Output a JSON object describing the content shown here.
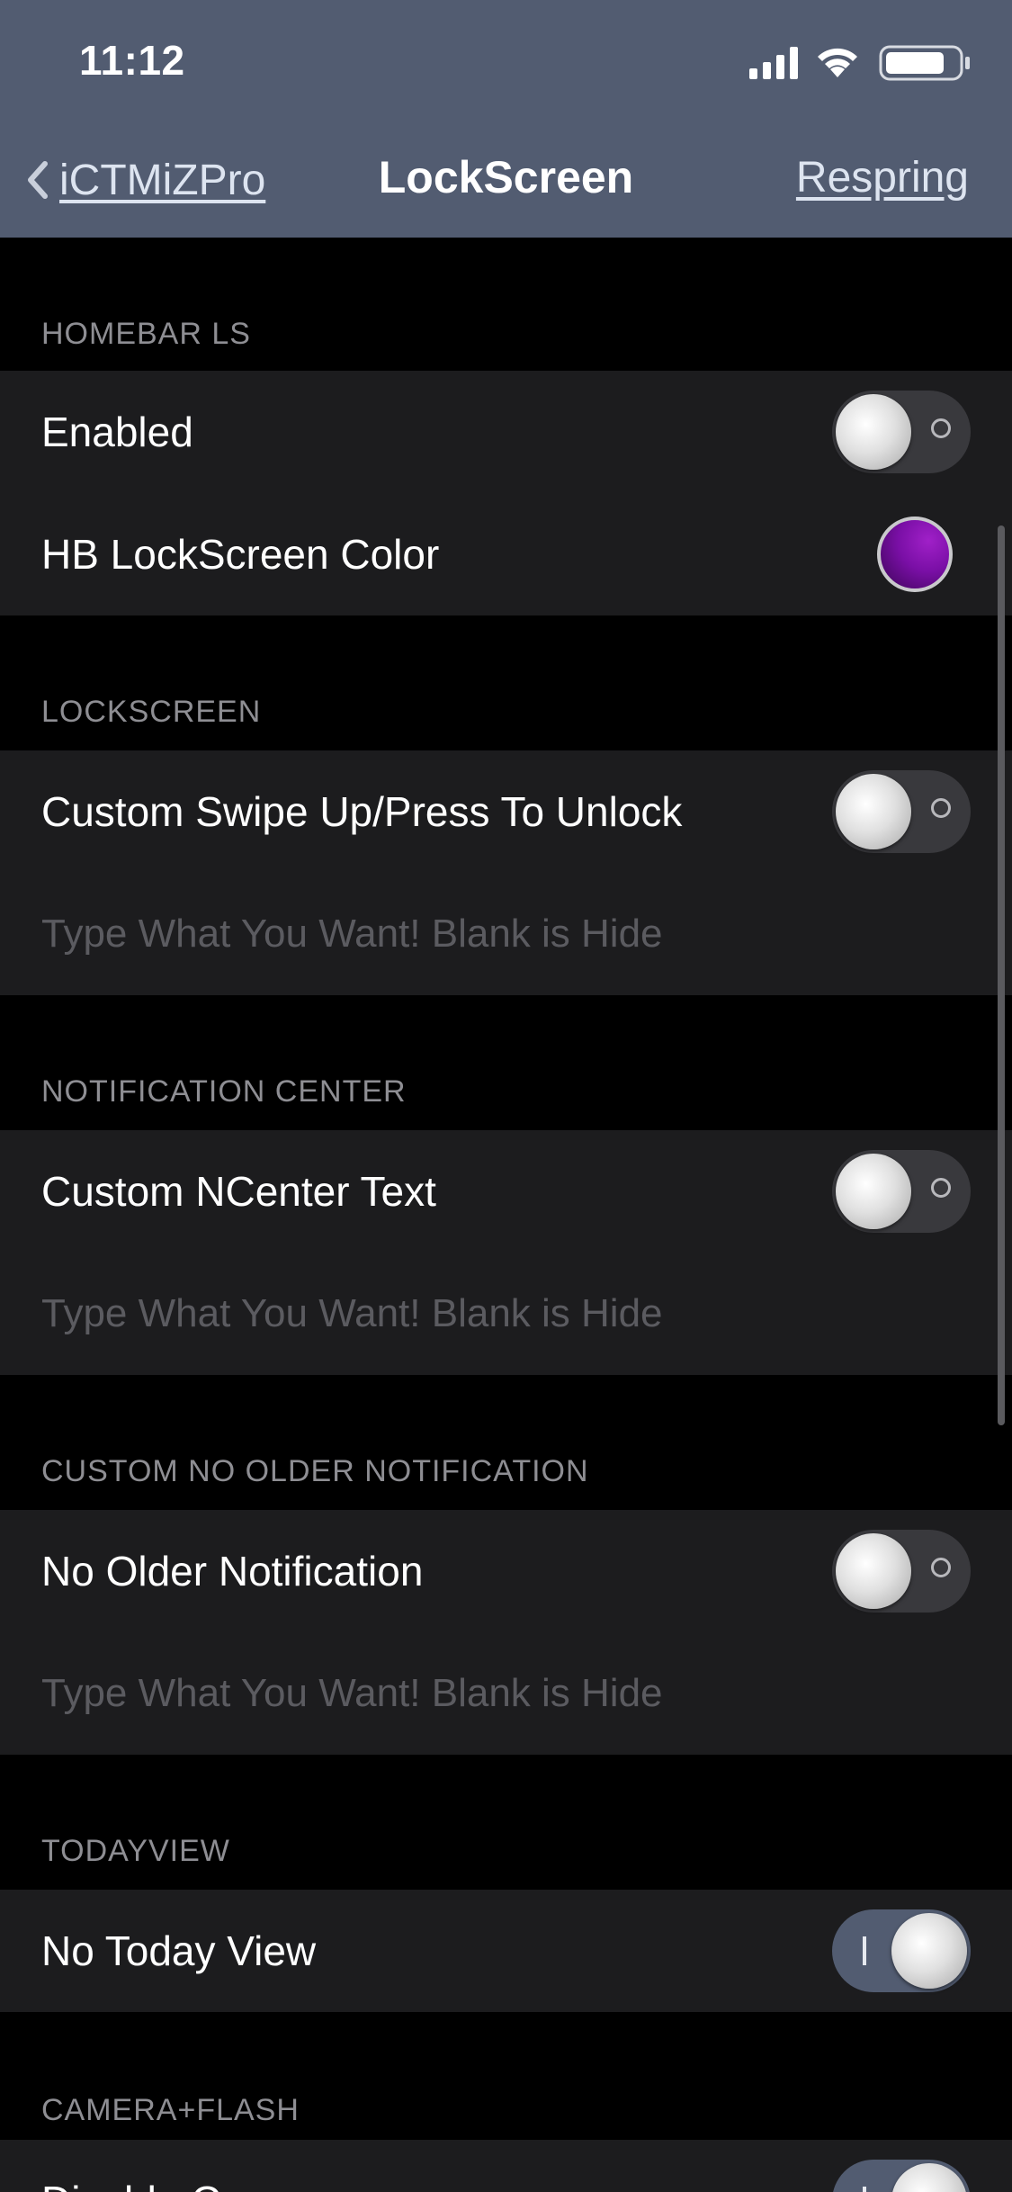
{
  "status_bar": {
    "time": "11:12"
  },
  "nav": {
    "back_label": "iCTMiZPro",
    "title": "LockScreen",
    "action_label": "Respring"
  },
  "sections": [
    {
      "header": "HOMEBAR LS",
      "rows": [
        {
          "label": "Enabled",
          "toggle": "off"
        },
        {
          "label": "HB LockScreen Color",
          "color": "#7a0fa6"
        }
      ]
    },
    {
      "header": "LOCKSCREEN",
      "rows": [
        {
          "label": "Custom Swipe Up/Press To Unlock",
          "toggle": "off"
        },
        {
          "placeholder": "Type What You Want! Blank is Hide"
        }
      ]
    },
    {
      "header": "NOTIFICATION CENTER",
      "rows": [
        {
          "label": "Custom NCenter Text",
          "toggle": "off"
        },
        {
          "placeholder": "Type What You Want! Blank is Hide"
        }
      ]
    },
    {
      "header": "CUSTOM NO OLDER NOTIFICATION",
      "rows": [
        {
          "label": "No Older Notification",
          "toggle": "off"
        },
        {
          "placeholder": "Type What You Want! Blank is Hide"
        }
      ]
    },
    {
      "header": "TODAYVIEW",
      "rows": [
        {
          "label": "No Today View",
          "toggle": "on"
        }
      ]
    },
    {
      "header": "CAMERA+FLASH",
      "rows": [
        {
          "label": "Disable Camera",
          "toggle": "on"
        }
      ]
    }
  ],
  "colors": {
    "nav_background": "#525c71",
    "cell_background": "#1c1c1e",
    "toggle_on": "#525c71",
    "toggle_off": "#39393d"
  }
}
